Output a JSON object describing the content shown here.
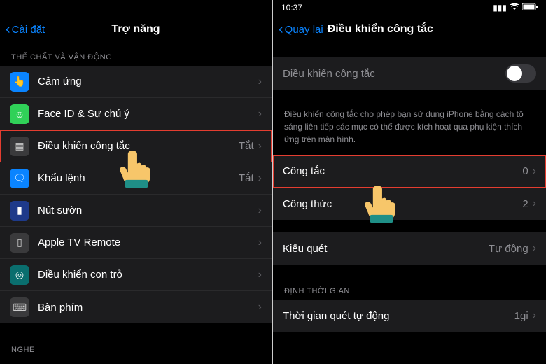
{
  "left": {
    "back_label": "Cài đặt",
    "title": "Trợ năng",
    "section1": "THỂ CHẤT VÀ VẬN ĐỘNG",
    "rows": [
      {
        "label": "Cảm ứng",
        "value": "",
        "icon": "touch-icon"
      },
      {
        "label": "Face ID & Sự chú ý",
        "value": "",
        "icon": "faceid-icon"
      },
      {
        "label": "Điều khiển công tắc",
        "value": "Tắt",
        "icon": "switch-control-icon"
      },
      {
        "label": "Khẩu lệnh",
        "value": "Tắt",
        "icon": "voice-icon"
      },
      {
        "label": "Nút sườn",
        "value": "",
        "icon": "side-button-icon"
      },
      {
        "label": "Apple TV Remote",
        "value": "",
        "icon": "tv-remote-icon"
      },
      {
        "label": "Điều khiển con trỏ",
        "value": "",
        "icon": "pointer-icon"
      },
      {
        "label": "Bàn phím",
        "value": "",
        "icon": "keyboard-icon"
      }
    ],
    "section2": "NGHE"
  },
  "right": {
    "time": "10:37",
    "back_label": "Quay lại",
    "title": "Điều khiển công tắc",
    "toggle_label": "Điều khiển công tắc",
    "desc": "Điều khiển công tắc cho phép bạn sử dụng iPhone bằng cách tô sáng liên tiếp các mục có thể được kích hoạt qua phụ kiện thích ứng trên màn hình.",
    "rows2": [
      {
        "label": "Công tắc",
        "value": "0"
      },
      {
        "label": "Công thức",
        "value": "2"
      }
    ],
    "row_scan_label": "Kiểu quét",
    "row_scan_value": "Tự động",
    "section_time": "ĐỊNH THỜI GIAN",
    "row_time_label": "Thời gian quét tự động",
    "row_time_value": "1gi"
  }
}
